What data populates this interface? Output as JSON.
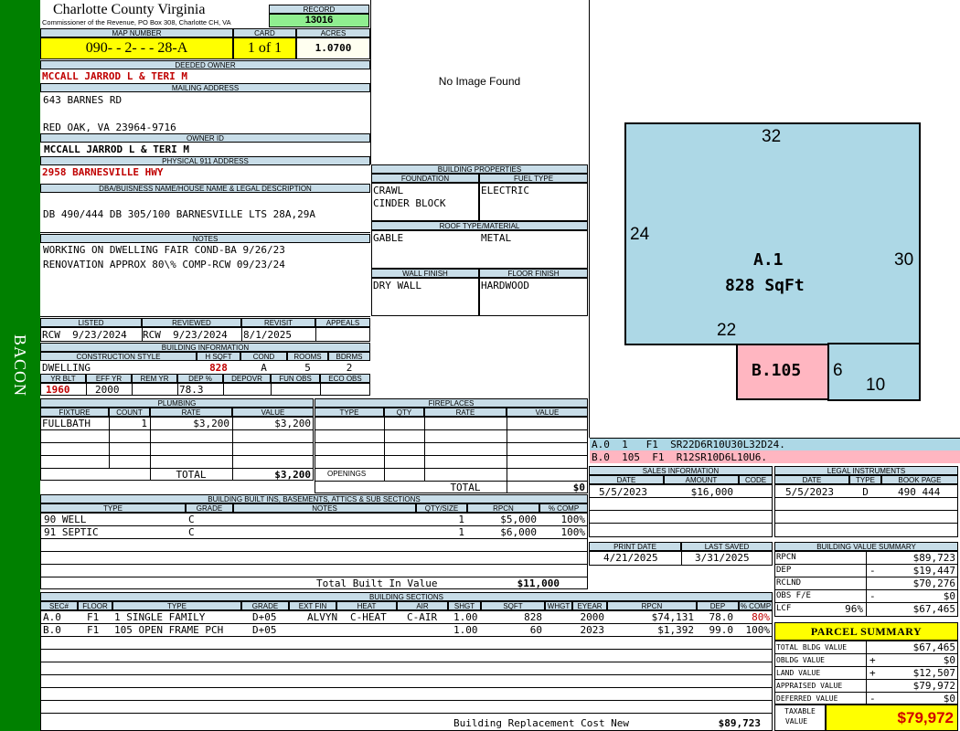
{
  "sidebar": {
    "label": "BACON",
    "color": "#008000"
  },
  "header": {
    "county": "Charlotte County Virginia",
    "office": "Commissioner of the Revenue, PO Box 308, Charlotte CH, VA",
    "record_label": "RECORD",
    "record": "13016",
    "map_label": "MAP NUMBER",
    "map_number": "090- - 2- - - 28-A",
    "card_label": "CARD",
    "card": "1 of 1",
    "acres_label": "ACRES",
    "acres": "1.0700"
  },
  "owner": {
    "deeded_label": "DEEDED OWNER",
    "deeded": "MCCALL JARROD L & TERI M",
    "mailing_label": "MAILING ADDRESS",
    "mailing1": "643 BARNES RD",
    "mailing2": "RED OAK, VA 23964-9716",
    "ownerid_label": "OWNER ID",
    "ownerid": "MCCALL JARROD L & TERI M",
    "physical_label": "PHYSICAL 911 ADDRESS",
    "physical": "2958 BARNESVILLE HWY"
  },
  "legal": {
    "label": "DBA/BUISNESS NAME/HOUSE NAME & LEGAL DESCRIPTION",
    "text": "DB 490/444 DB 305/100 BARNESVILLE LTS 28A,29A"
  },
  "notes": {
    "label": "NOTES",
    "line1": "WORKING ON DWELLING FAIR COND-BA 9/26/23",
    "line2": "RENOVATION APPROX 80\\% COMP-RCW 09/23/24"
  },
  "image": {
    "text": "No Image Found"
  },
  "building_props": {
    "label": "BUILDING PROPERTIES",
    "foundation_label": "FOUNDATION",
    "foundation1": "CRAWL",
    "foundation2": "CINDER BLOCK",
    "fuel_label": "FUEL TYPE",
    "fuel": "ELECTRIC",
    "roof_label": "ROOF TYPE/MATERIAL",
    "roof_type": "GABLE",
    "roof_mat": "METAL",
    "wall_label": "WALL FINISH",
    "wall": "DRY WALL",
    "floor_label": "FLOOR FINISH",
    "floor": "HARDWOOD"
  },
  "review": {
    "listed_label": "LISTED",
    "listed": "RCW  9/23/2024",
    "reviewed_label": "REVIEWED",
    "reviewed": "RCW  9/23/2024",
    "revisit_label": "REVISIT",
    "revisit": "8/1/2025",
    "appeals_label": "APPEALS"
  },
  "building_info": {
    "label": "BUILDING INFORMATION",
    "style_label": "CONSTRUCTION STYLE",
    "style": "DWELLING",
    "hsqft_label": "H SQFT",
    "hsqft": "828",
    "cond_label": "COND",
    "cond": "A",
    "rooms_label": "ROOMS",
    "rooms": "5",
    "bdrms_label": "BDRMS",
    "bdrms": "2",
    "yrblt_label": "YR BLT",
    "yrblt": "1960",
    "effyr_label": "EFF YR",
    "effyr": "2000",
    "remyr_label": "REM YR",
    "dep_label": "DEP %",
    "dep": "78.3",
    "depovr_label": "DEPOVR",
    "funobs_label": "FUN OBS",
    "ecoobs_label": "ECO OBS"
  },
  "plumbing": {
    "label": "PLUMBING",
    "headers": [
      "FIXTURE",
      "COUNT",
      "RATE",
      "VALUE"
    ],
    "fixture": "FULLBATH",
    "count": "1",
    "rate": "$3,200",
    "value": "$3,200",
    "total_label": "TOTAL",
    "total": "$3,200"
  },
  "fireplaces": {
    "label": "FIREPLACES",
    "headers": [
      "TYPE",
      "QTY",
      "RATE",
      "VALUE"
    ],
    "openings_label": "OPENINGS",
    "total_label": "TOTAL",
    "total": "$0"
  },
  "builtins": {
    "label": "BUILDING BUILT INS, BASEMENTS, ATTICS & SUB SECTIONS",
    "headers": [
      "TYPE",
      "GRADE",
      "NOTES",
      "QTY/SIZE",
      "RPCN",
      "% COMP"
    ],
    "rows": [
      {
        "type": "90 WELL",
        "grade": "C",
        "qty": "1",
        "rpcn": "$5,000",
        "comp": "100%"
      },
      {
        "type": "91 SEPTIC",
        "grade": "C",
        "qty": "1",
        "rpcn": "$6,000",
        "comp": "100%"
      }
    ],
    "total_label": "Total Built In Value",
    "total": "$11,000"
  },
  "sections": {
    "label": "BUILDING SECTIONS",
    "headers": [
      "SEC#",
      "FLOOR",
      "TYPE",
      "GRADE",
      "EXT FIN",
      "HEAT",
      "AIR",
      "SHGT",
      "SQFT",
      "WHGT",
      "EYEAR",
      "RPCN",
      "DEP",
      "% COMP"
    ],
    "rows": [
      {
        "sec": "A.0",
        "floor": "F1",
        "type": "1 SINGLE FAMILY",
        "grade": "D+05",
        "extfin": "ALVYN",
        "heat": "C-HEAT",
        "air": "C-AIR",
        "shgt": "1.00",
        "sqft": "828",
        "whgt": "",
        "eyear": "2000",
        "rpcn": "$74,131",
        "dep": "78.0",
        "comp": "80%"
      },
      {
        "sec": "B.0",
        "floor": "F1",
        "type": "105 OPEN FRAME PCH",
        "grade": "D+05",
        "extfin": "",
        "heat": "",
        "air": "",
        "shgt": "1.00",
        "sqft": "60",
        "whgt": "",
        "eyear": "2023",
        "rpcn": "$1,392",
        "dep": "99.0",
        "comp": "100%"
      }
    ],
    "replacement_label": "Building Replacement Cost New",
    "replacement": "$89,723"
  },
  "sketch": {
    "a_label": "A.1",
    "a_area": "828 SqFt",
    "b_label": "B.105",
    "dims": {
      "top": "32",
      "left": "24",
      "right": "30",
      "bottom_a": "22",
      "b_right": "6",
      "b_bottom": "10"
    },
    "a_color": "#add8e6",
    "b_color": "#ffb6c1",
    "codes": [
      {
        "text": "A.0  1   F1  SR22D6R10U30L32D24."
      },
      {
        "text": "B.0  105  F1  R12SR10D6L10U6."
      }
    ]
  },
  "sales": {
    "label": "SALES INFORMATION",
    "headers": [
      "DATE",
      "AMOUNT",
      "CODE"
    ],
    "date": "5/5/2023",
    "amount": "$16,000",
    "code": ""
  },
  "legal_instr": {
    "label": "LEGAL INSTRUMENTS",
    "headers": [
      "DATE",
      "TYPE",
      "BOOK PAGE"
    ],
    "date": "5/5/2023",
    "type": "D",
    "bookpage": "490 444"
  },
  "print": {
    "print_label": "PRINT DATE",
    "print": "4/21/2025",
    "saved_label": "LAST SAVED",
    "saved": "3/31/2025"
  },
  "value_summary": {
    "label": "BUILDING VALUE SUMMARY",
    "rows": [
      {
        "k": "RPCN",
        "s": "",
        "v": "$89,723"
      },
      {
        "k": "DEP",
        "s": "-",
        "v": "$19,447"
      },
      {
        "k": "RCLND",
        "s": "",
        "v": "$70,276"
      },
      {
        "k": "OBS F/E",
        "s": "-",
        "v": "$0"
      },
      {
        "k": "LCF",
        "p": "96%",
        "s": "",
        "v": "$67,465"
      }
    ]
  },
  "parcel": {
    "label": "PARCEL SUMMARY",
    "rows": [
      {
        "k": "TOTAL BLDG VALUE",
        "s": "",
        "v": "$67,465"
      },
      {
        "k": "OBLDG VALUE",
        "s": "+",
        "v": "$0"
      },
      {
        "k": "LAND VALUE",
        "s": "+",
        "v": "$12,507"
      },
      {
        "k": "APPRAISED VALUE",
        "s": "",
        "v": "$79,972"
      },
      {
        "k": "DEFERRED VALUE",
        "s": "-",
        "v": "$0"
      }
    ],
    "taxable_label1": "TAXABLE",
    "taxable_label2": "VALUE",
    "taxable": "$79,972"
  }
}
